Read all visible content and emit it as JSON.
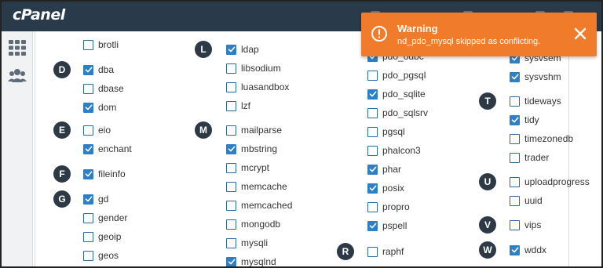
{
  "app": {
    "logo_text": "cPanel"
  },
  "sidebar": {
    "items": [
      {
        "icon": "grid-icon"
      },
      {
        "icon": "users-icon"
      }
    ]
  },
  "toast": {
    "type": "warning",
    "title": "Warning",
    "message": "nd_pdo_mysql skipped as conflicting.",
    "icon": "alert-circle-icon",
    "close_icon": "close-icon"
  },
  "colors": {
    "topbar": "#293a4a",
    "toast": "#f07b2a",
    "checkbox": "#2f7fc4",
    "letter_badge": "#2d3a46"
  },
  "columns": [
    {
      "groups": [
        {
          "letter": "",
          "items": [
            {
              "name": "brotli",
              "checked": false
            }
          ]
        },
        {
          "letter": "D",
          "items": [
            {
              "name": "dba",
              "checked": true
            },
            {
              "name": "dbase",
              "checked": false
            },
            {
              "name": "dom",
              "checked": true
            }
          ]
        },
        {
          "letter": "E",
          "items": [
            {
              "name": "eio",
              "checked": false
            },
            {
              "name": "enchant",
              "checked": true
            }
          ]
        },
        {
          "letter": "F",
          "items": [
            {
              "name": "fileinfo",
              "checked": true
            }
          ]
        },
        {
          "letter": "G",
          "items": [
            {
              "name": "gd",
              "checked": true
            },
            {
              "name": "gender",
              "checked": false
            },
            {
              "name": "geoip",
              "checked": false
            },
            {
              "name": "geos",
              "checked": false
            }
          ]
        }
      ]
    },
    {
      "groups": [
        {
          "letter": "L",
          "items": [
            {
              "name": "ldap",
              "checked": true
            },
            {
              "name": "libsodium",
              "checked": false
            },
            {
              "name": "luasandbox",
              "checked": false
            },
            {
              "name": "lzf",
              "checked": false
            }
          ]
        },
        {
          "letter": "M",
          "items": [
            {
              "name": "mailparse",
              "checked": false
            },
            {
              "name": "mbstring",
              "checked": true
            },
            {
              "name": "mcrypt",
              "checked": false
            },
            {
              "name": "memcache",
              "checked": false
            },
            {
              "name": "memcached",
              "checked": false
            },
            {
              "name": "mongodb",
              "checked": false
            },
            {
              "name": "mysqli",
              "checked": false
            },
            {
              "name": "mysqlnd",
              "checked": true
            }
          ]
        }
      ]
    },
    {
      "groups": [
        {
          "letter": "",
          "items": [
            {
              "name": "pdo_odbc",
              "checked": true
            },
            {
              "name": "pdo_pgsql",
              "checked": false
            },
            {
              "name": "pdo_sqlite",
              "checked": true
            },
            {
              "name": "pdo_sqlsrv",
              "checked": false
            },
            {
              "name": "pgsql",
              "checked": false
            },
            {
              "name": "phalcon3",
              "checked": false
            },
            {
              "name": "phar",
              "checked": true
            },
            {
              "name": "posix",
              "checked": true
            },
            {
              "name": "propro",
              "checked": false
            },
            {
              "name": "pspell",
              "checked": true
            }
          ]
        },
        {
          "letter": "R",
          "items": [
            {
              "name": "raphf",
              "checked": false
            }
          ]
        }
      ]
    },
    {
      "groups": [
        {
          "letter": "",
          "items": [
            {
              "name": "sysvsem",
              "checked": true
            },
            {
              "name": "sysvshm",
              "checked": true
            }
          ]
        },
        {
          "letter": "T",
          "items": [
            {
              "name": "tideways",
              "checked": false
            },
            {
              "name": "tidy",
              "checked": true
            },
            {
              "name": "timezonedb",
              "checked": false
            },
            {
              "name": "trader",
              "checked": false
            }
          ]
        },
        {
          "letter": "U",
          "items": [
            {
              "name": "uploadprogress",
              "checked": false
            },
            {
              "name": "uuid",
              "checked": false
            }
          ]
        },
        {
          "letter": "V",
          "items": [
            {
              "name": "vips",
              "checked": false
            }
          ]
        },
        {
          "letter": "W",
          "items": [
            {
              "name": "wddx",
              "checked": true
            }
          ]
        }
      ]
    }
  ]
}
